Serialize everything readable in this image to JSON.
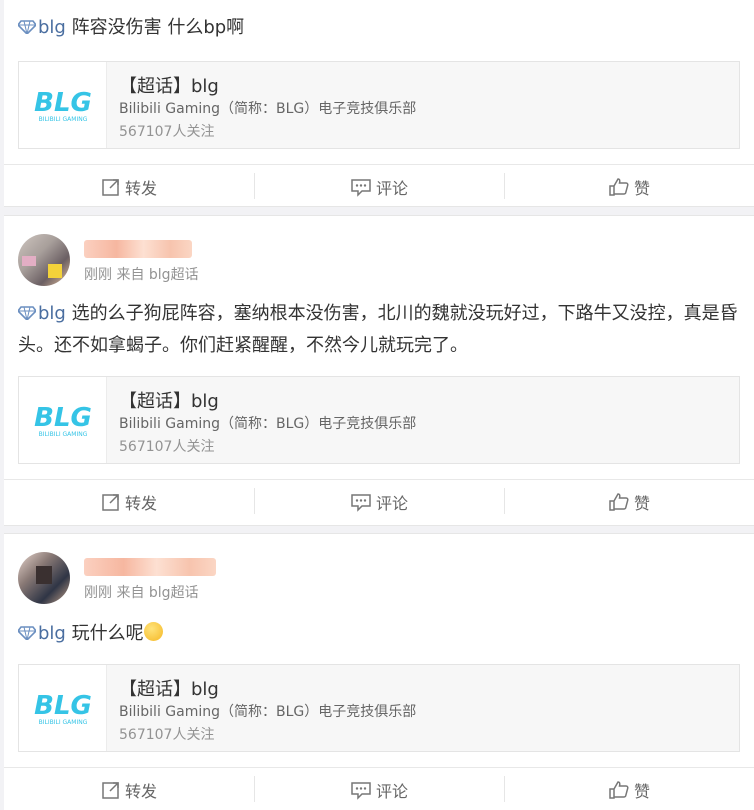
{
  "posts": [
    {
      "has_header": false,
      "tag": "blg",
      "text": "阵容没伤害 什么bp啊",
      "link": {
        "title": "【超话】blg",
        "subtitle": "Bilibili Gaming（简称：BLG）电子竞技俱乐部",
        "followers": "567107人关注"
      },
      "actions": {
        "repost": "转发",
        "comment": "评论",
        "like": "赞"
      }
    },
    {
      "has_header": true,
      "meta": "刚刚 来自 blg超话",
      "tag": "blg",
      "text": "选的么子狗屁阵容，塞纳根本没伤害，北川的魏就没玩好过，下路牛又没控，真是昏头。还不如拿蝎子。你们赶紧醒醒，不然今儿就玩完了。",
      "link": {
        "title": "【超话】blg",
        "subtitle": "Bilibili Gaming（简称：BLG）电子竞技俱乐部",
        "followers": "567107人关注"
      },
      "actions": {
        "repost": "转发",
        "comment": "评论",
        "like": "赞"
      }
    },
    {
      "has_header": true,
      "meta": "刚刚 来自 blg超话",
      "tag": "blg",
      "text": "玩什么呢",
      "emoji": "smile-emoji",
      "link": {
        "title": "【超话】blg",
        "subtitle": "Bilibili Gaming（简称：BLG）电子竞技俱乐部",
        "followers": "567107人关注"
      },
      "actions": {
        "repost": "转发",
        "comment": "评论",
        "like": "赞"
      }
    }
  ],
  "logo": {
    "text": "BLG",
    "tagline": "BILIBILI GAMING",
    "color": "#35c4e6"
  },
  "colors": {
    "tag": "#4a6ea0",
    "meta": "#939393"
  },
  "icons": {
    "superchat": "diamond-icon",
    "repost": "repost-icon",
    "comment": "comment-icon",
    "like": "thumbs-up-icon"
  }
}
